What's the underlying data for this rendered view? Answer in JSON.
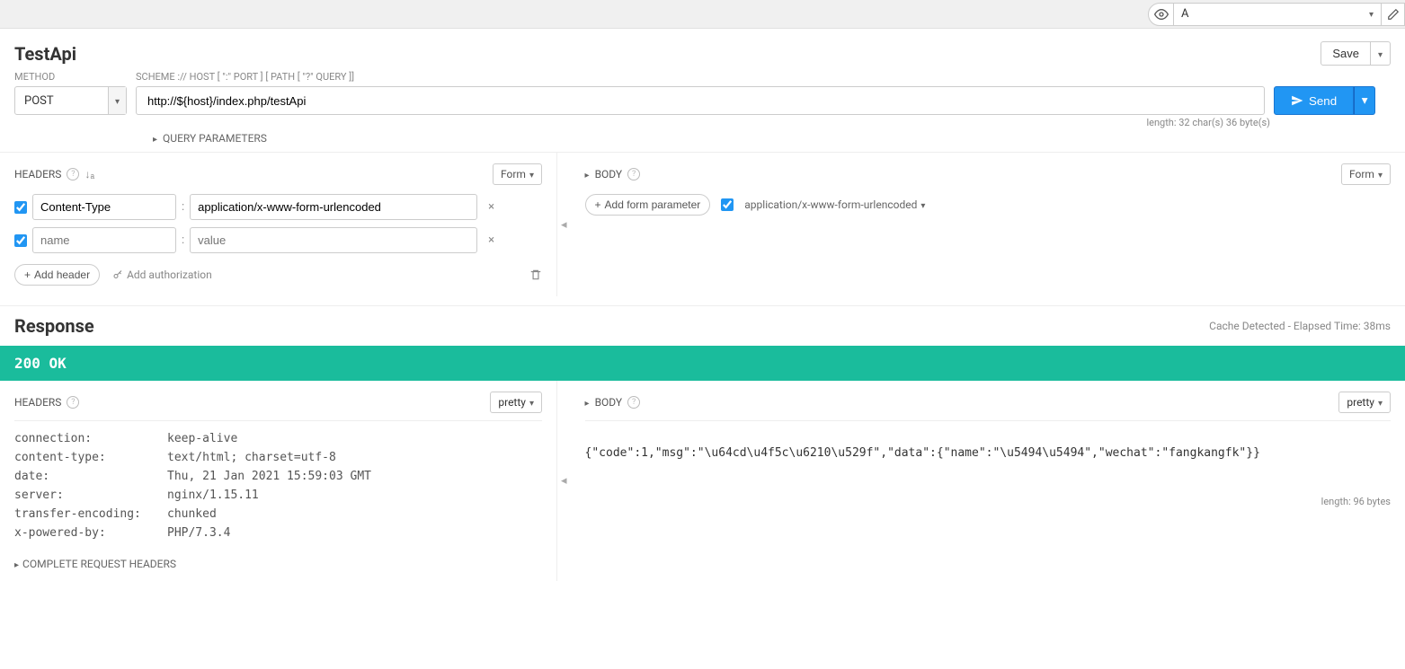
{
  "topbar": {
    "env": "A"
  },
  "request": {
    "title": "TestApi",
    "save_label": "Save",
    "method_label": "METHOD",
    "method_value": "POST",
    "url_label": "SCHEME :// HOST [ \":\" PORT ] [ PATH [ \"?\" QUERY ]]",
    "url_value": "http://${host}/index.php/testApi",
    "send_label": "Send",
    "length_hint": "length: 32 char(s) 36 byte(s)",
    "query_params_label": "QUERY PARAMETERS"
  },
  "headers_panel": {
    "label": "HEADERS",
    "form_label": "Form",
    "rows": [
      {
        "checked": true,
        "name": "Content-Type",
        "value": "application/x-www-form-urlencoded"
      },
      {
        "checked": true,
        "name": "",
        "value": ""
      }
    ],
    "name_placeholder": "name",
    "value_placeholder": "value",
    "add_header_label": "Add header",
    "add_auth_label": "Add authorization"
  },
  "body_panel": {
    "label": "BODY",
    "form_label": "Form",
    "add_param_label": "Add form parameter",
    "content_type": "application/x-www-form-urlencoded"
  },
  "response": {
    "title": "Response",
    "cache_info": "Cache Detected - Elapsed Time: 38ms",
    "status": "200  OK",
    "headers_label": "HEADERS",
    "body_label": "BODY",
    "pretty_label": "pretty",
    "headers": [
      {
        "k": "connection:",
        "v": "keep-alive"
      },
      {
        "k": "content-type:",
        "v": "text/html; charset=utf-8"
      },
      {
        "k": "date:",
        "v": "Thu, 21 Jan 2021 15:59:03 GMT"
      },
      {
        "k": "server:",
        "v": "nginx/1.15.11"
      },
      {
        "k": "transfer-encoding:",
        "v": "chunked"
      },
      {
        "k": "x-powered-by:",
        "v": "PHP/7.3.4"
      }
    ],
    "complete_headers_label": "COMPLETE REQUEST HEADERS",
    "body_text": "{\"code\":1,\"msg\":\"\\u64cd\\u4f5c\\u6210\\u529f\",\"data\":{\"name\":\"\\u5494\\u5494\",\"wechat\":\"fangkangfk\"}}",
    "body_length": "length: 96 bytes"
  }
}
